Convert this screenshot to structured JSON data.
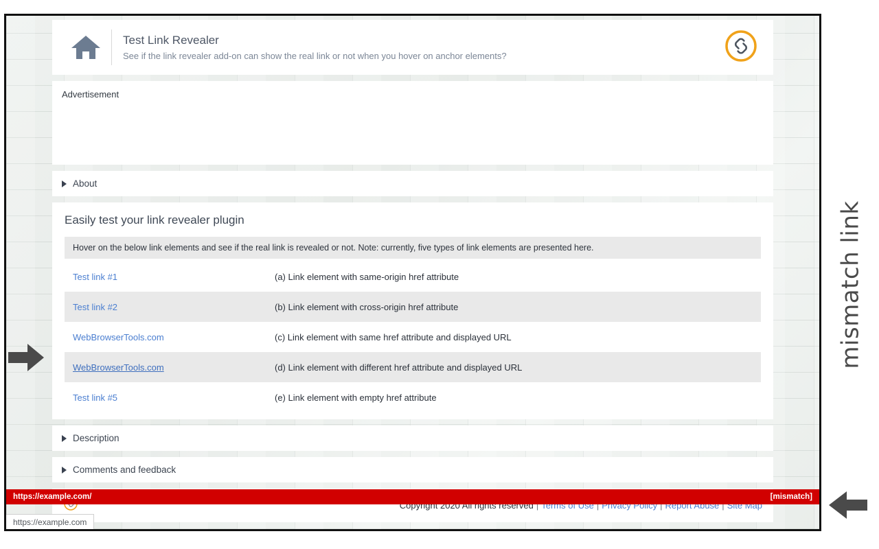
{
  "header": {
    "title": "Test Link Revealer",
    "subtitle": "See if the link revealer add-on can show the real link or not when you hover on anchor elements?",
    "home_icon": "home-icon",
    "brand_icon": "link-badge-icon"
  },
  "advertisement": {
    "label": "Advertisement"
  },
  "sections": {
    "about": "About",
    "description": "Description",
    "comments": "Comments and feedback"
  },
  "main": {
    "heading": "Easily test your link revealer plugin",
    "note": "Hover on the below link elements and see if the real link is revealed or not. Note: currently, five types of link elements are presented here.",
    "rows": [
      {
        "link": "Test link #1",
        "desc": "(a) Link element with same-origin href attribute",
        "hovered": false
      },
      {
        "link": "Test link #2",
        "desc": "(b) Link element with cross-origin href attribute",
        "hovered": false
      },
      {
        "link": "WebBrowserTools.com",
        "desc": "(c) Link element with same href attribute and displayed URL",
        "hovered": false
      },
      {
        "link": "WebBrowserTools.com",
        "desc": "(d) Link element with different href attribute and displayed URL",
        "hovered": true
      },
      {
        "link": "Test link #5",
        "desc": "(e) Link element with empty href attribute",
        "hovered": false
      }
    ]
  },
  "footer": {
    "badge_icon": "link-badge-small-icon",
    "copyright": "Copyright 2020 All rights reserved",
    "links": [
      "Terms of Use",
      "Privacy Policy",
      "Report Abuse",
      "Site Map"
    ],
    "separator": "|"
  },
  "reveal_bar": {
    "url": "https://example.com/",
    "flag": "[mismatch]",
    "background": "#d10000",
    "text_color": "#ffffff"
  },
  "status_tip": {
    "url": "https://example.com"
  },
  "annotations": {
    "vertical_label": "mismatch link",
    "left_arrow": "arrow-right-icon",
    "right_arrow": "arrow-left-icon",
    "color": "#4a4a4a"
  },
  "colors": {
    "link": "#4a7ed0",
    "accent_orange": "#f0a21a",
    "row_alt": "#e9e9e9",
    "page_bg": "#ffffff"
  }
}
